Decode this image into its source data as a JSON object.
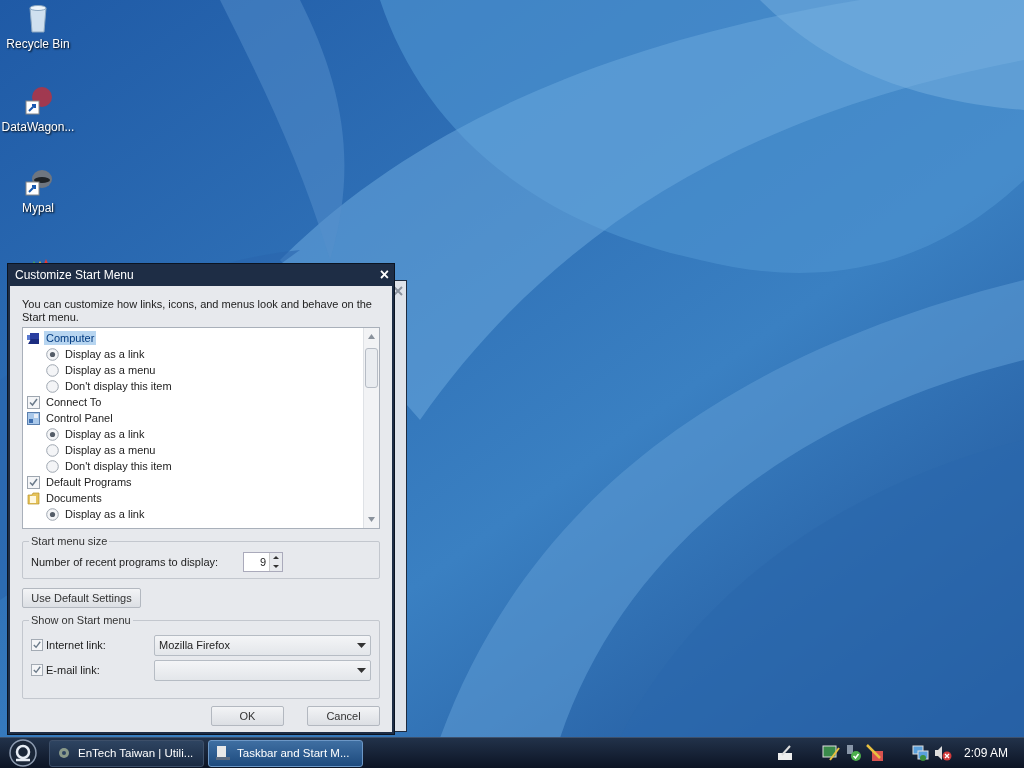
{
  "desktop_icons": [
    {
      "label": "Recycle Bin",
      "kind": "bin"
    },
    {
      "label": "DataWagon...",
      "kind": "wagon"
    },
    {
      "label": "Mypal",
      "kind": "mypal"
    },
    {
      "kind": "blocks"
    }
  ],
  "dialog": {
    "title": "Customize Start Menu",
    "close": "×",
    "description": "You can customize how links, icons, and menus look and behave on the Start menu.",
    "items": [
      {
        "kind": "computer",
        "label": "Computer",
        "selected": true,
        "children": [
          {
            "kind": "radio",
            "label": "Display as a link",
            "selected": true
          },
          {
            "kind": "radio",
            "label": "Display as a menu",
            "selected": false
          },
          {
            "kind": "radio",
            "label": "Don't display this item",
            "selected": false
          }
        ]
      },
      {
        "kind": "checkbox",
        "label": "Connect To",
        "selected": false,
        "checked": true
      },
      {
        "kind": "panel",
        "label": "Control Panel",
        "selected": false,
        "children": [
          {
            "kind": "radio",
            "label": "Display as a link",
            "selected": true
          },
          {
            "kind": "radio",
            "label": "Display as a menu",
            "selected": false
          },
          {
            "kind": "radio",
            "label": "Don't display this item",
            "selected": false
          }
        ]
      },
      {
        "kind": "checkbox",
        "label": "Default Programs",
        "selected": false,
        "checked": true
      },
      {
        "kind": "folder",
        "label": "Documents",
        "selected": false,
        "children": [
          {
            "kind": "radio",
            "label": "Display as a link",
            "selected": true
          }
        ]
      }
    ],
    "size_group": {
      "title": "Start menu size",
      "label": "Number of recent programs to display:",
      "value": "9"
    },
    "default_button": "Use Default Settings",
    "show_group": {
      "title": "Show on Start menu",
      "rows": [
        {
          "label": "Internet link:",
          "checked": true,
          "value": "Mozilla Firefox"
        },
        {
          "label": "E-mail link:",
          "checked": true
        }
      ]
    },
    "buttons": [
      "OK",
      "Cancel"
    ]
  },
  "taskbar": {
    "tasks": [
      {
        "label": "EnTech Taiwan | Utili...",
        "selected": false,
        "kind": "gear"
      },
      {
        "label": "Taskbar and Start M...",
        "selected": true,
        "kind": "taskbar"
      }
    ],
    "clock": "2:09 AM"
  }
}
